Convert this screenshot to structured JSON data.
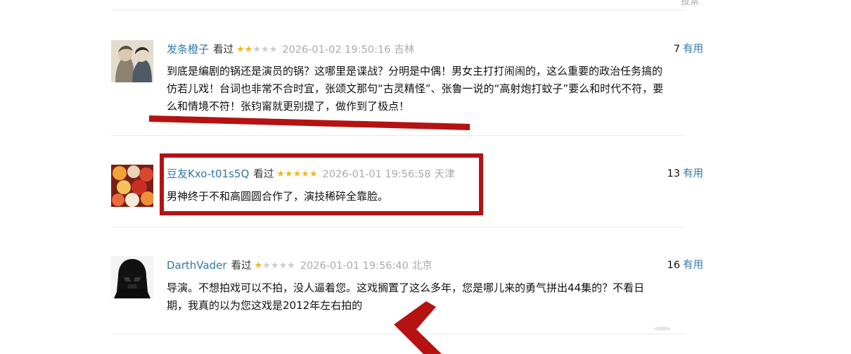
{
  "page": {
    "top_link": "投票"
  },
  "comments": [
    {
      "username": "发条橙子",
      "watched": "看过",
      "rating": 2,
      "date": "2026-01-02 19:50:16",
      "location": "吉林",
      "useful_count": "7",
      "useful_label": "有用",
      "lines": [
        "到底是编剧的锅还是演员的锅？这哪里是谍战？分明是中偶！男女主打打闹闹的，这么重要的政治任务搞的",
        "仿若儿戏！台词也非常不合时宜，张颂文那句“古灵精怪”、张鲁一说的“高射炮打蚊子”要么和时代不符，要",
        "么和情境不符！张钧甯就更别提了，做作到了极点！"
      ]
    },
    {
      "username": "豆友Kxo-t01s5Q",
      "watched": "看过",
      "rating": 5,
      "date": "2026-01-01 19:56:58",
      "location": "天津",
      "useful_count": "13",
      "useful_label": "有用",
      "lines": [
        "男神终于不和高圆圆合作了，演技稀碎全靠脸。"
      ]
    },
    {
      "username": "DarthVader",
      "watched": "看过",
      "rating": 1,
      "date": "2026-01-01 19:56:40",
      "location": "北京",
      "useful_count": "16",
      "useful_label": "有用",
      "lines": [
        "导演。不想拍戏可以不拍，没人逼着您。这戏搁置了这么多年，您是哪儿来的勇气拼出44集的？不看日",
        "期，我真的以为您这戏是2012年左右拍的"
      ]
    }
  ],
  "colors": {
    "link": "#3377aa",
    "star": "#f3b51c",
    "meta": "#aaaaaa",
    "annotation": "#b51212"
  },
  "icons": [
    "star-icon"
  ]
}
